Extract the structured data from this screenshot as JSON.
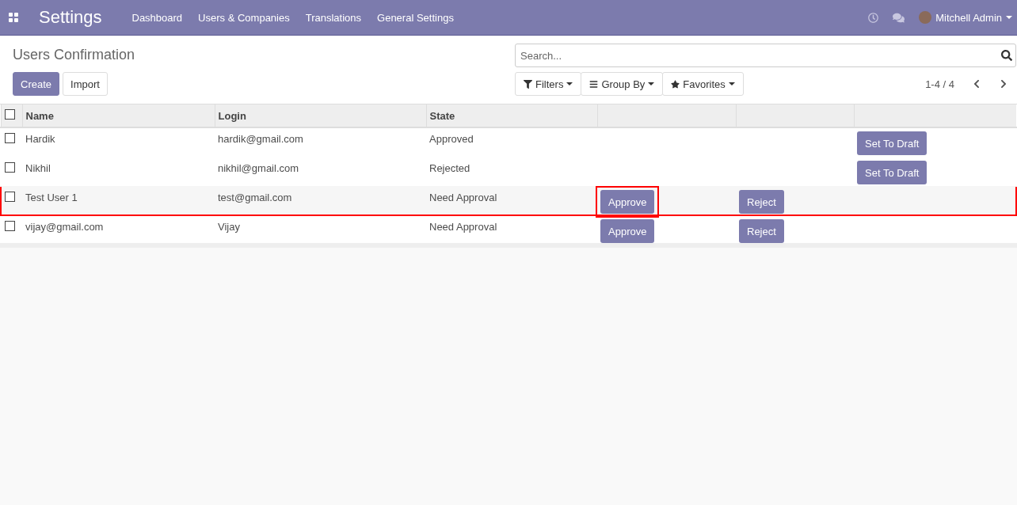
{
  "navbar": {
    "app_title": "Settings",
    "menu": [
      "Dashboard",
      "Users & Companies",
      "Translations",
      "General Settings"
    ],
    "user": "Mitchell Admin"
  },
  "control_panel": {
    "title": "Users Confirmation",
    "buttons": [
      {
        "label": "Create",
        "kind": "primary"
      },
      {
        "label": "Import",
        "kind": "secondary"
      }
    ],
    "search": {
      "placeholder": "Search..."
    },
    "filters": [
      {
        "label": "Filters",
        "kind": "filter"
      },
      {
        "label": "Group By",
        "kind": "group"
      },
      {
        "label": "Favorites",
        "kind": "star"
      }
    ],
    "pager": "1-4 / 4"
  },
  "table": {
    "all_checked": false,
    "columns": [
      "Name",
      "Login",
      "State"
    ],
    "rows": [
      {
        "checked": false,
        "highlighted": false,
        "cells": [
          "Hardik",
          "hardik@gmail.com",
          "Approved"
        ],
        "actions": [
          {
            "kind": "draft",
            "label": "Set To Draft",
            "highlighted": false
          }
        ]
      },
      {
        "checked": false,
        "highlighted": false,
        "cells": [
          "Nikhil",
          "nikhil@gmail.com",
          "Rejected"
        ],
        "actions": [
          {
            "kind": "draft",
            "label": "Set To Draft",
            "highlighted": false
          }
        ]
      },
      {
        "checked": false,
        "highlighted": true,
        "cells": [
          "Test User 1",
          "test@gmail.com",
          "Need Approval"
        ],
        "actions": [
          {
            "kind": "approve",
            "label": "Approve",
            "highlighted": true
          },
          {
            "kind": "reject",
            "label": "Reject",
            "highlighted": false
          }
        ]
      },
      {
        "checked": false,
        "highlighted": false,
        "cells": [
          "vijay@gmail.com",
          "Vijay",
          "Need Approval"
        ],
        "actions": [
          {
            "kind": "approve",
            "label": "Approve",
            "highlighted": false
          },
          {
            "kind": "reject",
            "label": "Reject",
            "highlighted": false
          }
        ]
      }
    ]
  }
}
